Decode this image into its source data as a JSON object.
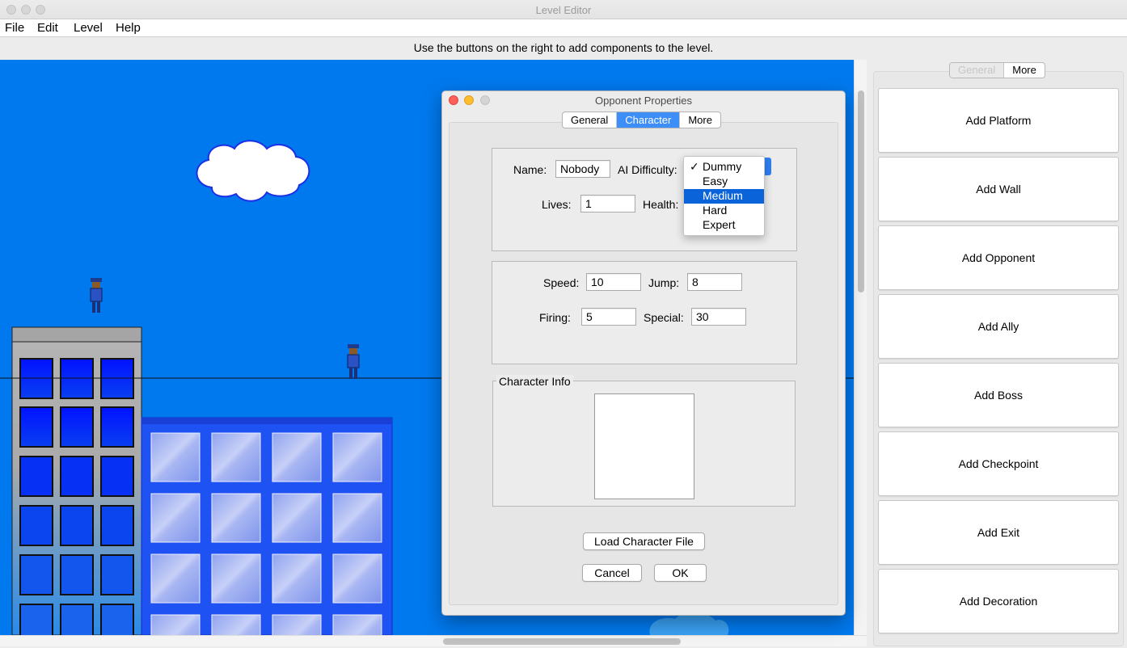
{
  "window": {
    "title": "Level Editor"
  },
  "menu": [
    "File",
    "Edit",
    "Level",
    "Help"
  ],
  "hint": "Use the buttons on the right to add components to the level.",
  "panel": {
    "tabs": [
      "General",
      "More"
    ],
    "buttons": [
      "Add Platform",
      "Add Wall",
      "Add Opponent",
      "Add Ally",
      "Add Boss",
      "Add Checkpoint",
      "Add Exit",
      "Add Decoration"
    ]
  },
  "dialog": {
    "title": "Opponent Properties",
    "tabs": [
      "General",
      "Character",
      "More"
    ],
    "selected_tab": "Character",
    "name_label": "Name:",
    "name_value": "Nobody",
    "ai_label": "AI Difficulty:",
    "ai_options": [
      "Dummy",
      "Easy",
      "Medium",
      "Hard",
      "Expert"
    ],
    "ai_checked": "Dummy",
    "ai_highlighted": "Medium",
    "check_mark": "✓",
    "lives_label": "Lives:",
    "lives_value": "1",
    "health_label": "Health:",
    "speed_label": "Speed:",
    "speed_value": "10",
    "jump_label": "Jump:",
    "jump_value": "8",
    "firing_label": "Firing:",
    "firing_value": "5",
    "special_label": "Special:",
    "special_value": "30",
    "char_info_label": "Character Info",
    "load_button": "Load Character File",
    "cancel_button": "Cancel",
    "ok_button": "OK"
  },
  "colors": {
    "sky": "#0079ee",
    "selected_tab": "#3d8ff7",
    "highlight": "#0b63d9",
    "close": "#fe5f57",
    "minimize": "#febc2e"
  }
}
